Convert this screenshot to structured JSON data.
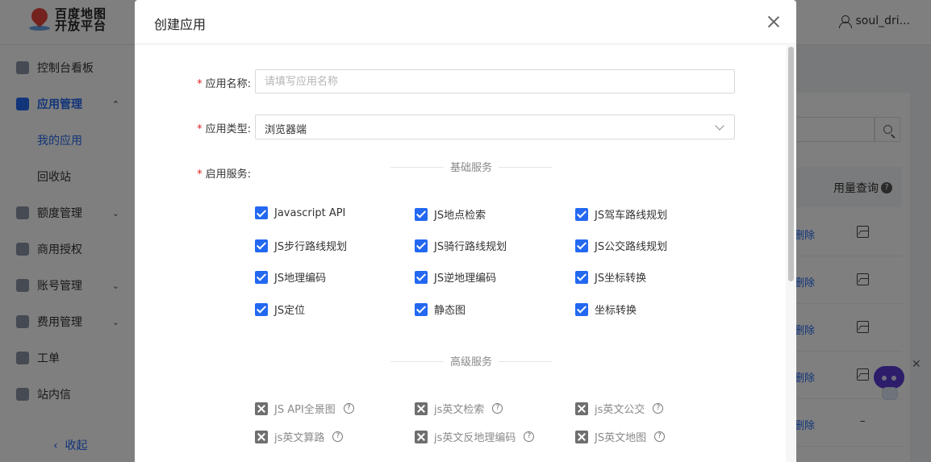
{
  "app": {
    "logo_line1": "百度地图",
    "logo_line2": "开放平台",
    "user_name": "soul_dri..."
  },
  "sidebar": {
    "items": [
      {
        "label": "控制台看板",
        "icon": "dashboard-icon"
      },
      {
        "label": "应用管理",
        "icon": "apps-icon",
        "active": true
      },
      {
        "label": "我的应用"
      },
      {
        "label": "回收站"
      },
      {
        "label": "额度管理",
        "icon": "quota-icon"
      },
      {
        "label": "商用授权",
        "icon": "briefcase-icon"
      },
      {
        "label": "账号管理",
        "icon": "gear-icon"
      },
      {
        "label": "费用管理",
        "icon": "bill-icon"
      },
      {
        "label": "工单",
        "icon": "ticket-icon"
      },
      {
        "label": "站内信",
        "icon": "mail-icon"
      }
    ],
    "collapse_label": "收起"
  },
  "background_table": {
    "usage_header": "用量查询",
    "rows": [
      {
        "action": "删除",
        "usage": "chart-icon"
      },
      {
        "action": "删除",
        "usage": "chart-icon"
      },
      {
        "action": "删除",
        "usage": "chart-icon"
      },
      {
        "action": "删除",
        "usage": "chart-icon"
      },
      {
        "action": "删除",
        "usage": "–"
      }
    ]
  },
  "dialog": {
    "title": "创建应用",
    "fields": {
      "name_label": "应用名称:",
      "name_placeholder": "请填写应用名称",
      "name_value": "",
      "type_label": "应用类型:",
      "type_value": "浏览器端",
      "service_label": "启用服务:"
    },
    "basic_section": "基础服务",
    "basic_services": [
      "Javascript API",
      "JS地点检索",
      "JS驾车路线规划",
      "JS步行路线规划",
      "JS骑行路线规划",
      "JS公交路线规划",
      "JS地理编码",
      "JS逆地理编码",
      "JS坐标转换",
      "JS定位",
      "静态图",
      "坐标转换"
    ],
    "advanced_section": "高级服务",
    "advanced_services": [
      "JS API全景图",
      "js英文检索",
      "js英文公交",
      "js英文算路",
      "js英文反地理编码",
      "JS英文地图"
    ]
  },
  "colors": {
    "accent": "#2468f2",
    "required": "#e02020",
    "disabled_checkbox": "#6f6f6f"
  }
}
